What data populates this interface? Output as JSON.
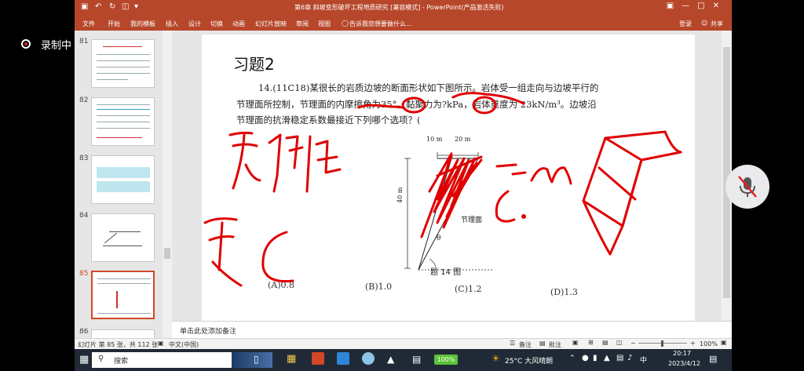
{
  "overlay": {
    "recording_label": "录制中"
  },
  "window": {
    "title": "第6章 斜坡变形破坏工程地质研究 [兼容模式] - PowerPoint(产品激活失败)",
    "login": "登录",
    "share": "共享"
  },
  "ribbon": {
    "tabs": [
      "文件",
      "开始",
      "我的模板",
      "插入",
      "设计",
      "切换",
      "动画",
      "幻灯片放映",
      "审阅",
      "视图"
    ],
    "tell_me": "告诉我您想要做什么..."
  },
  "thumbnails": [
    {
      "num": "81"
    },
    {
      "num": "82"
    },
    {
      "num": "83"
    },
    {
      "num": "84"
    },
    {
      "num": "85",
      "selected": true
    },
    {
      "num": "86"
    }
  ],
  "slide": {
    "title": "习题2",
    "question_line1": "14.(11C18)某很长的岩质边坡的断面形状如下图所示。岩体受一组走向与边坡平行的",
    "question_line2": "节理面所控制，节理面的内摩擦角为35°，黏聚力为?kPa，岩体重度为 23kN/m³。边坡沿",
    "question_line3": "节理面的抗滑稳定系数最接近下列哪个选项？(",
    "figure": {
      "dim_top_1": "10 m",
      "dim_top_2": "20 m",
      "dim_height": "40 m",
      "angle": "θ",
      "joint_label": "节理面",
      "caption": "题 14 图"
    },
    "options": [
      "(A)0.8",
      "(B)1.0",
      "(C)1.2",
      "(D)1.3"
    ]
  },
  "notes_placeholder": "单击此处添加备注",
  "status": {
    "slide_info": "幻灯片 第 85 张，共 112 张",
    "language": "中文(中国)",
    "notes_btn": "备注",
    "comments_btn": "批注",
    "zoom": "100%"
  },
  "taskbar": {
    "search_placeholder": "搜索",
    "battery": "100%",
    "weather": "25°C 大风晴朗",
    "ime": "中",
    "time": "20:17",
    "date": "2023/4/12"
  },
  "colors": {
    "accent": "#b7472a",
    "ink": "#e00000"
  }
}
